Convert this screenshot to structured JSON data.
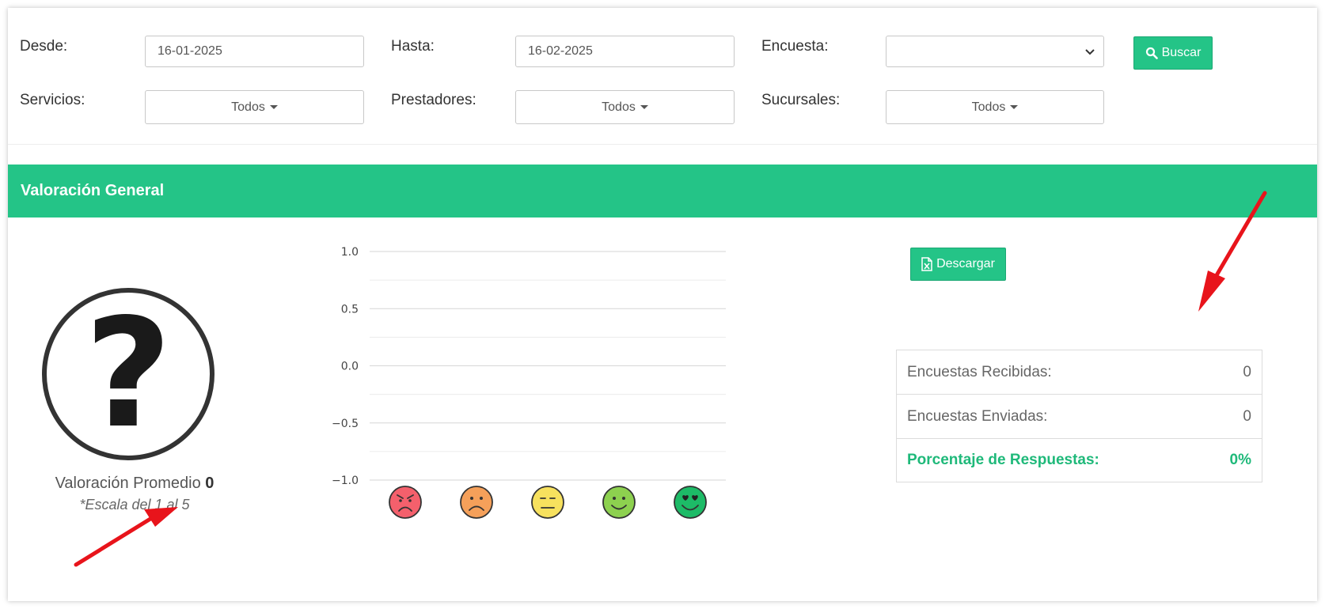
{
  "filters": {
    "desde_label": "Desde:",
    "desde_value": "16-01-2025",
    "hasta_label": "Hasta:",
    "hasta_value": "16-02-2025",
    "encuesta_label": "Encuesta:",
    "encuesta_value": "",
    "buscar_label": "Buscar",
    "servicios_label": "Servicios:",
    "servicios_value": "Todos",
    "prestadores_label": "Prestadores:",
    "prestadores_value": "Todos",
    "sucursales_label": "Sucursales:",
    "sucursales_value": "Todos"
  },
  "section": {
    "title": "Valoración General"
  },
  "rating": {
    "symbol": "?",
    "label": "Valoración Promedio",
    "value": "0",
    "scale": "*Escala del 1 al 5"
  },
  "download_label": "Descargar",
  "stats": {
    "received_label": "Encuestas Recibidas:",
    "received_value": "0",
    "sent_label": "Encuestas Enviadas:",
    "sent_value": "0",
    "percent_label": "Porcentaje de Respuestas:",
    "percent_value": "0%"
  },
  "chart_data": {
    "type": "bar",
    "categories": [
      "very-angry-face",
      "sad-face",
      "neutral-face",
      "smiling-face",
      "heart-eyes-face"
    ],
    "values": [
      0,
      0,
      0,
      0,
      0
    ],
    "ylim": [
      -1.0,
      1.0
    ],
    "yticks": [
      "1.0",
      "0.5",
      "0.0",
      "−0.5",
      "−1.0"
    ],
    "grid": true,
    "category_colors": [
      "#f4606c",
      "#f5a05a",
      "#f7e15e",
      "#8dd14f",
      "#1dbb67"
    ]
  },
  "colors": {
    "accent": "#24c487",
    "accent_text": "#1fb97a"
  }
}
